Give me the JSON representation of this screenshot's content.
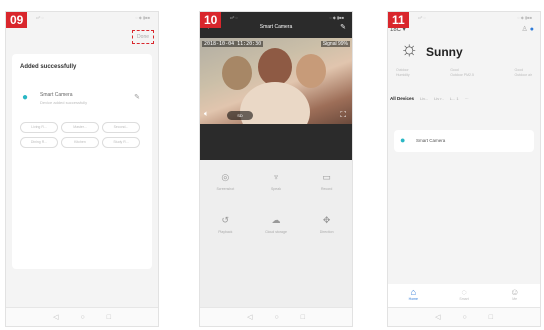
{
  "steps": [
    "09",
    "10",
    "11"
  ],
  "screen1": {
    "status_left": "••º ◌",
    "status_right": "◌ ◆ ▮■■",
    "done_label": "Done",
    "added_title": "Added successfully",
    "device_name": "Smart Camera",
    "device_sub": "Device added successfully",
    "rooms": [
      "Living R...",
      "Master...",
      "Second...",
      "Dining R...",
      "Kitchen",
      "Study R..."
    ]
  },
  "screen2": {
    "status_left": "••º ◌",
    "status_right": "◌ ◆ ▮■■",
    "title": "Smart Camera",
    "timestamp": "2018-10-04 11:20:30",
    "signal": "Signal 99%",
    "quality": "SD",
    "controls": [
      {
        "icon": "◎",
        "label": "Screenshot"
      },
      {
        "icon": "♆",
        "label": "Speak"
      },
      {
        "icon": "▭",
        "label": "Record"
      },
      {
        "icon": "↺",
        "label": "Playback"
      },
      {
        "icon": "☁",
        "label": "Cloud storage"
      },
      {
        "icon": "✥",
        "label": "Direction"
      }
    ]
  },
  "screen3": {
    "status_left": "••º ◌",
    "status_right": "◌ ◆ ▮■■",
    "temp_label": "18C ▾",
    "weather": "Sunny",
    "stats": [
      {
        "label": "Outdoor",
        "value": "Humidity"
      },
      {
        "label": "Good",
        "value": "Outdoor PM2.5"
      },
      {
        "label": "Good",
        "value": "Outdoor air"
      }
    ],
    "rooms": [
      "All Devices",
      "Liv...",
      "Liv r..",
      "L... 1",
      "···"
    ],
    "device_name": "Smart Camera",
    "tabs": [
      "Home",
      "Smart",
      "Me"
    ]
  },
  "colors": {
    "badge": "#d9262c",
    "accent": "#2f7bd8",
    "device": "#2ab7c4"
  }
}
